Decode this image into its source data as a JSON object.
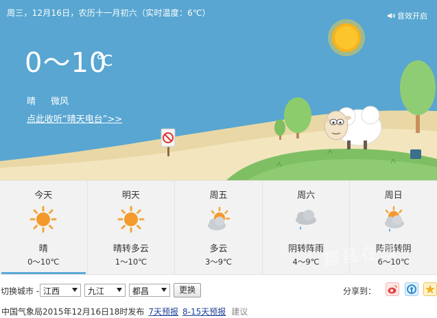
{
  "header": {
    "date_line": "周三，12月16日，农历十一月初六（实时温度：6℃）",
    "sound_label": "音效开启"
  },
  "current": {
    "temp_range": "0～10",
    "temp_unit": "℃",
    "condition": "晴",
    "wind": "微风",
    "radio_link": "点此收听“晴天电台”>>"
  },
  "forecast": [
    {
      "day": "今天",
      "icon": "sun-icon",
      "condition": "晴",
      "temp": "0～10℃",
      "active": true
    },
    {
      "day": "明天",
      "icon": "sun-icon",
      "condition": "晴转多云",
      "temp": "1～10℃",
      "active": false
    },
    {
      "day": "周五",
      "icon": "partly-cloudy-icon",
      "condition": "多云",
      "temp": "3～9℃",
      "active": false
    },
    {
      "day": "周六",
      "icon": "cloud-rain-icon",
      "condition": "阴转阵雨",
      "temp": "4～9℃",
      "active": false
    },
    {
      "day": "周日",
      "icon": "sun-cloud-rain-icon",
      "condition": "阵雨转阴",
      "temp": "6～10℃",
      "active": false
    }
  ],
  "controls": {
    "switch_label": "切换城市 -",
    "province": "江西",
    "city": "九江",
    "district": "都昌",
    "switch_button": "更换",
    "share_label": "分享到："
  },
  "footer": {
    "publisher": "中国气象局2015年12月16日18时发布",
    "link_7day": "7天预报",
    "link_15day": "8-15天预报",
    "suggest": "建议"
  },
  "watermark": "都昌在线",
  "colors": {
    "sky": "#58a6d1",
    "sun": "#f7b21c",
    "grass": "#82c06a",
    "sand": "#f0e2b6",
    "active_tab": "#5ba8d6",
    "link": "#1c3f95"
  }
}
